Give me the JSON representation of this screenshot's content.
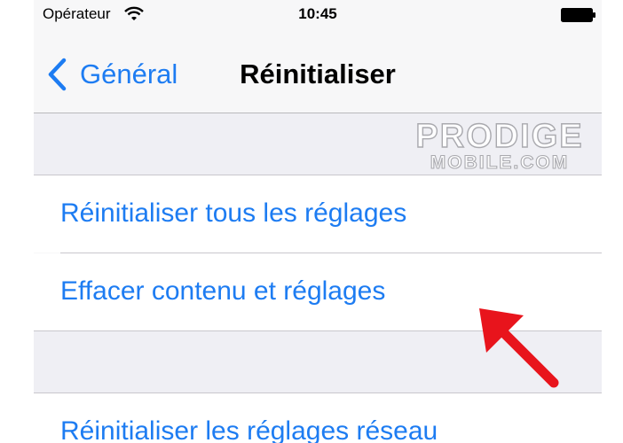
{
  "status_bar": {
    "carrier": "Opérateur",
    "time": "10:45"
  },
  "nav": {
    "back_label": "Général",
    "title": "Réinitialiser"
  },
  "cells": [
    {
      "label": "Réinitialiser tous les réglages"
    },
    {
      "label": "Effacer contenu et réglages"
    },
    {
      "label": "Réinitialiser les réglages réseau"
    }
  ],
  "watermark": {
    "line1": "PRODIGE",
    "line2": "MOBILE.COM"
  },
  "colors": {
    "accent": "#1d7cf2",
    "annotation_arrow": "#e8141c"
  },
  "icons": {
    "wifi": "wifi-icon",
    "battery": "battery-icon",
    "back": "chevron-left-icon",
    "annotation": "arrow-icon"
  }
}
